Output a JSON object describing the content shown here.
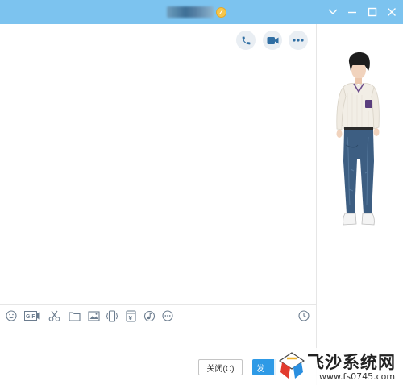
{
  "window": {
    "title_badge": "Z",
    "controls": {
      "dropdown_icon": "chevron-down-icon",
      "minimize_icon": "minimize-icon",
      "maximize_icon": "maximize-icon",
      "close_icon": "close-icon"
    },
    "title_bar_color": "#7cc3ef"
  },
  "chat_actions": [
    "phone-icon",
    "video-call-icon",
    "more-options-icon"
  ],
  "toolbar": {
    "tools": [
      "emoji-icon",
      "gif-icon",
      "scissors-icon",
      "folder-icon",
      "image-icon",
      "phone-shake-icon",
      "red-packet-icon",
      "music-icon",
      "more-icon"
    ],
    "gif_label": "GIF",
    "yen_label": "¥",
    "history_icon": "clock-icon"
  },
  "footer": {
    "close_label": "关闭(C)",
    "send_label": "发"
  },
  "watermark": {
    "title": "飞沙系统网",
    "url": "www.fs0745.com"
  },
  "colors": {
    "accent": "#2e9ae6",
    "icon": "#6b7c8e"
  }
}
